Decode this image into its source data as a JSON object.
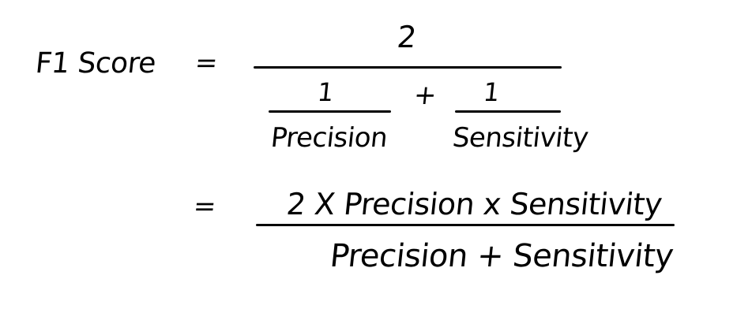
{
  "formula": {
    "lhs": "F1 Score",
    "equals_1": "=",
    "fraction_1": {
      "numerator": "2",
      "denominator": {
        "term_a": {
          "numerator": "1",
          "denominator": "Precision"
        },
        "operator": "+",
        "term_b": {
          "numerator": "1",
          "denominator": "Sensitivity"
        }
      }
    },
    "equals_2": "=",
    "fraction_2": {
      "numerator": "2 X  Precision x Sensitivity",
      "denominator": "Precision + Sensitivity"
    }
  }
}
